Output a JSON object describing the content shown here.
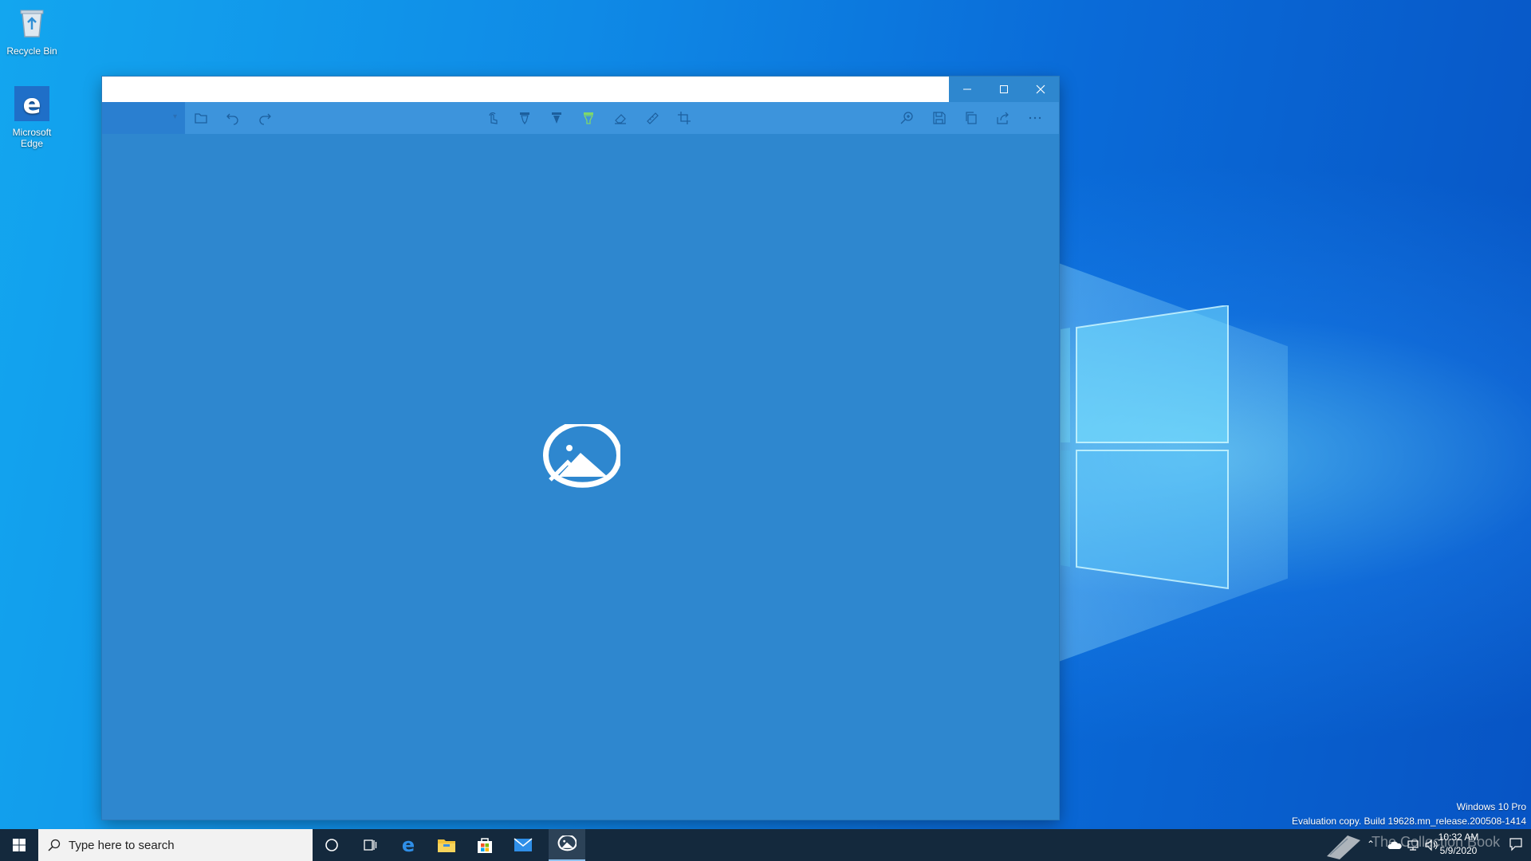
{
  "desktop": {
    "icons": [
      {
        "label": "Recycle Bin",
        "icon": "recycle-bin-icon"
      },
      {
        "label": "Microsoft Edge",
        "icon": "edge-icon"
      }
    ],
    "watermark": {
      "line1": "Windows 10 Pro",
      "line2": "Evaluation copy. Build 19628.mn_release.200508-1414"
    },
    "overlay_text": "The Collection Book"
  },
  "window": {
    "title_value": "",
    "toolbar": {
      "mode_label": "",
      "left_icons": [
        "open-folder-icon",
        "undo-icon",
        "redo-icon"
      ],
      "center_icons": [
        "touch-writing-icon",
        "ballpoint-pen-icon",
        "pencil-icon",
        "highlighter-icon",
        "eraser-icon",
        "ruler-icon",
        "crop-icon"
      ],
      "right_icons": [
        "zoom-in-icon",
        "save-icon",
        "copy-icon",
        "share-icon",
        "more-icon"
      ]
    },
    "accent": "#2e87cf"
  },
  "taskbar": {
    "search_placeholder": "Type here to search",
    "apps": [
      "cortana-icon",
      "task-view-icon",
      "edge-icon",
      "file-explorer-icon",
      "store-icon",
      "mail-icon",
      "snip-sketch-icon"
    ],
    "clock": {
      "time": "10:32 AM",
      "date": "5/9/2020"
    },
    "color": "#14293d"
  }
}
